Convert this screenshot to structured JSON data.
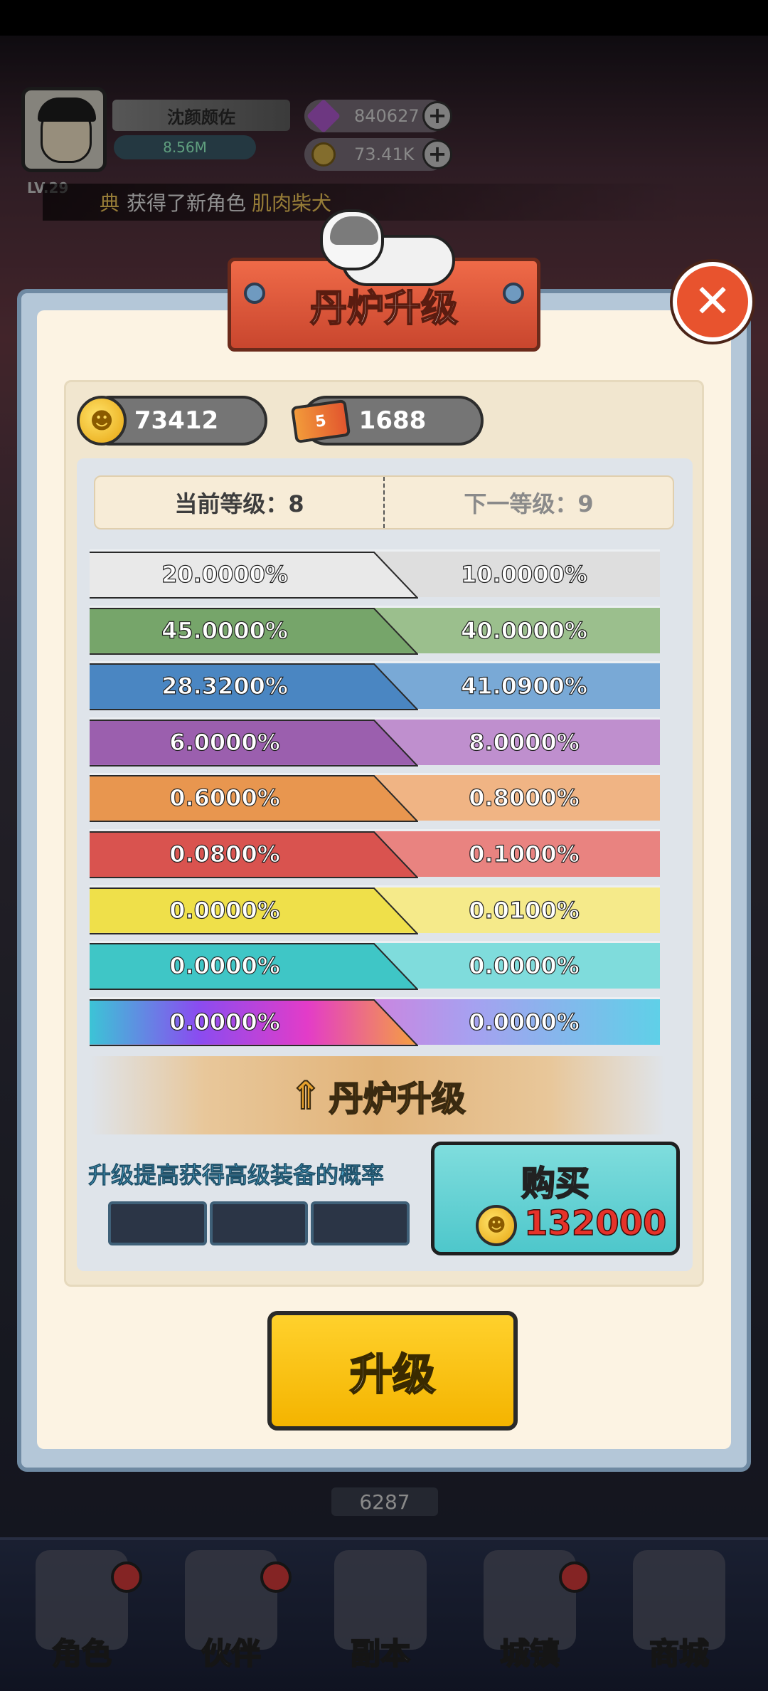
{
  "player": {
    "name": "沈颜颇佐",
    "power": "8.56M",
    "level": "LV.29",
    "gems": "840627",
    "gold": "73.41K"
  },
  "notice": {
    "prefix": "典",
    "text": "获得了新角色",
    "highlight": "肌肉柴犬"
  },
  "dialog": {
    "title": "丹炉升级",
    "close_icon": "close-icon",
    "currencies": {
      "coins": "73412",
      "tickets": "1688",
      "ticket_badge": "5"
    },
    "current_level_label": "当前等级：8",
    "next_level_label": "下一等级：9",
    "rows": [
      {
        "current": "20.0000%",
        "next": "10.0000%",
        "color_cur": "#e9e9e9",
        "color_next": "#dedede"
      },
      {
        "current": "45.0000%",
        "next": "40.0000%",
        "color_cur": "#76a56a",
        "color_next": "#9bbf8d"
      },
      {
        "current": "28.3200%",
        "next": "41.0900%",
        "color_cur": "#4a86c2",
        "color_next": "#79a9d6"
      },
      {
        "current": "6.0000%",
        "next": "8.0000%",
        "color_cur": "#9b5fae",
        "color_next": "#bf8fce"
      },
      {
        "current": "0.6000%",
        "next": "0.8000%",
        "color_cur": "#e8964f",
        "color_next": "#f0b484"
      },
      {
        "current": "0.0800%",
        "next": "0.1000%",
        "color_cur": "#d9534f",
        "color_next": "#e98380"
      },
      {
        "current": "0.0000%",
        "next": "0.0100%",
        "color_cur": "#efe04a",
        "color_next": "#f5ea8a"
      },
      {
        "current": "0.0000%",
        "next": "0.0000%",
        "color_cur": "#3fc6c6",
        "color_next": "#7fdcdc"
      },
      {
        "current": "0.0000%",
        "next": "0.0000%",
        "color_cur": "rainbow",
        "color_next": "rainbow"
      }
    ],
    "upgrade_strip_label": "丹炉升级",
    "description": "升级提高获得高级装备的概率",
    "buy_label": "购买",
    "buy_price": "132000",
    "upgrade_button": "升级"
  },
  "bottom_nav": {
    "items": [
      {
        "label": "角色"
      },
      {
        "label": "伙伴"
      },
      {
        "label": "副本"
      },
      {
        "label": "城镇"
      },
      {
        "label": "商城"
      }
    ]
  },
  "background_counter": "6287"
}
